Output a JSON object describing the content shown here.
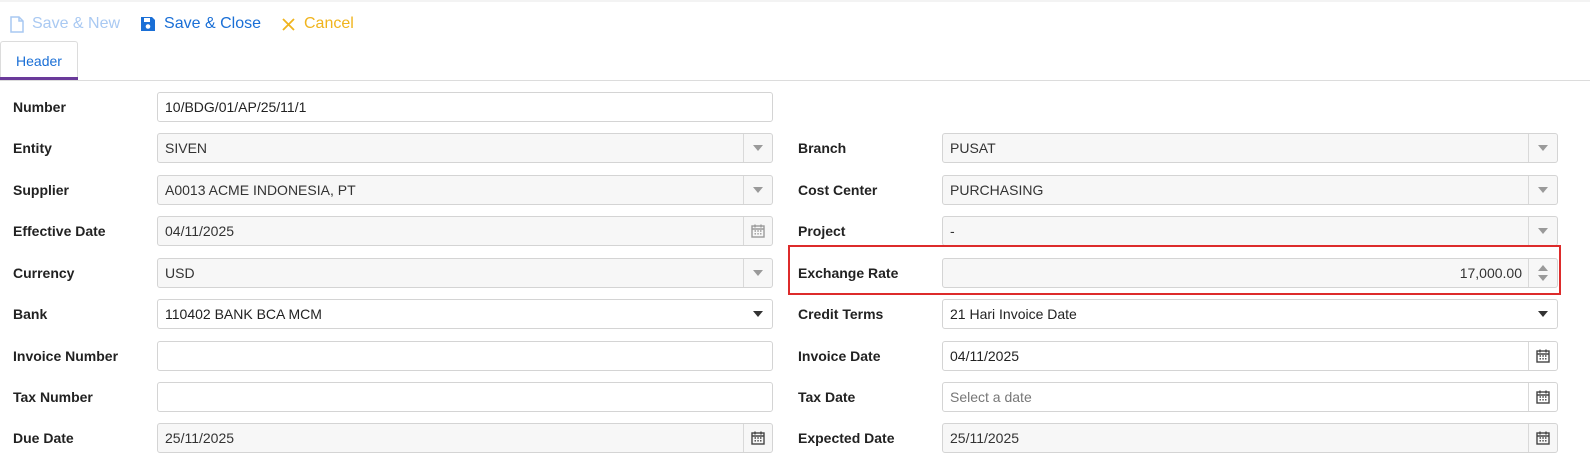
{
  "toolbar": {
    "save_new_label": "Save & New",
    "save_close_label": "Save & Close",
    "cancel_label": "Cancel"
  },
  "tabs": {
    "header_label": "Header"
  },
  "form": {
    "number": {
      "label": "Number",
      "value": "10/BDG/01/AP/25/11/1"
    },
    "entity": {
      "label": "Entity",
      "value": "SIVEN"
    },
    "supplier": {
      "label": "Supplier",
      "value": "A0013 ACME INDONESIA, PT"
    },
    "effective_date": {
      "label": "Effective Date",
      "value": "04/11/2025"
    },
    "currency": {
      "label": "Currency",
      "value": "USD"
    },
    "bank": {
      "label": "Bank",
      "value": "110402 BANK BCA MCM"
    },
    "invoice_number": {
      "label": "Invoice Number",
      "value": ""
    },
    "tax_number": {
      "label": "Tax Number",
      "value": ""
    },
    "due_date": {
      "label": "Due Date",
      "value": "25/11/2025"
    },
    "branch": {
      "label": "Branch",
      "value": "PUSAT"
    },
    "cost_center": {
      "label": "Cost Center",
      "value": "PURCHASING"
    },
    "project": {
      "label": "Project",
      "value": "-"
    },
    "exchange_rate": {
      "label": "Exchange Rate",
      "value": "17,000.00"
    },
    "credit_terms": {
      "label": "Credit Terms",
      "value": "21 Hari Invoice Date"
    },
    "invoice_date": {
      "label": "Invoice Date",
      "value": "04/11/2025"
    },
    "tax_date": {
      "label": "Tax Date",
      "value": "",
      "placeholder": "Select a date"
    },
    "expected_date": {
      "label": "Expected Date",
      "value": "25/11/2025"
    }
  },
  "colors": {
    "primary": "#1a6fd6",
    "disabled_primary": "#a9c9f2",
    "cancel": "#f0b41e",
    "tab_underline": "#6a3a9a",
    "highlight": "#dd2b2b"
  }
}
